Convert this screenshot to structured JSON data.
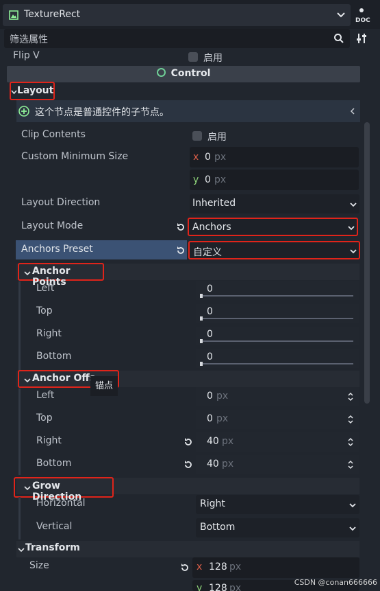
{
  "header": {
    "node_name": "TextureRect",
    "filter_placeholder": "筛选属性"
  },
  "rows": {
    "flip_v": {
      "label": "Flip V",
      "value": "启用"
    },
    "control_section": "Control",
    "layout_group": "Layout",
    "info_text": "这个节点是普通控件的子节点。",
    "clip_contents": {
      "label": "Clip Contents",
      "value": "启用"
    },
    "custom_min_size": {
      "label": "Custom Minimum Size",
      "x_label": "x",
      "x": "0",
      "y_label": "y",
      "y": "0",
      "unit": "px"
    },
    "layout_direction": {
      "label": "Layout Direction",
      "value": "Inherited"
    },
    "layout_mode": {
      "label": "Layout Mode",
      "value": "Anchors"
    },
    "anchors_preset": {
      "label": "Anchors Preset",
      "value": "自定义"
    }
  },
  "anchor_points": {
    "title": "Anchor Points",
    "items": [
      {
        "label": "Left",
        "value": "0"
      },
      {
        "label": "Top",
        "value": "0"
      },
      {
        "label": "Right",
        "value": "0"
      },
      {
        "label": "Bottom",
        "value": "0"
      }
    ]
  },
  "anchor_offsets": {
    "title": "Anchor Offs",
    "tooltip": "锚点",
    "unit": "px",
    "items": [
      {
        "label": "Left",
        "value": "0"
      },
      {
        "label": "Top",
        "value": "0"
      },
      {
        "label": "Right",
        "value": "40"
      },
      {
        "label": "Bottom",
        "value": "40"
      }
    ]
  },
  "grow_direction": {
    "title": "Grow Direction",
    "horizontal": {
      "label": "Horizontal",
      "value": "Right"
    },
    "vertical": {
      "label": "Vertical",
      "value": "Bottom"
    }
  },
  "transform": {
    "title": "Transform",
    "size": {
      "label": "Size",
      "x_label": "x",
      "x": "128",
      "y_label": "y",
      "y": "128",
      "unit": "px"
    }
  },
  "watermark": "CSDN @conan666666",
  "colors": {
    "accent_green": "#6fcf97",
    "highlight_red": "#e0241a",
    "panel_bg": "#21262e"
  }
}
